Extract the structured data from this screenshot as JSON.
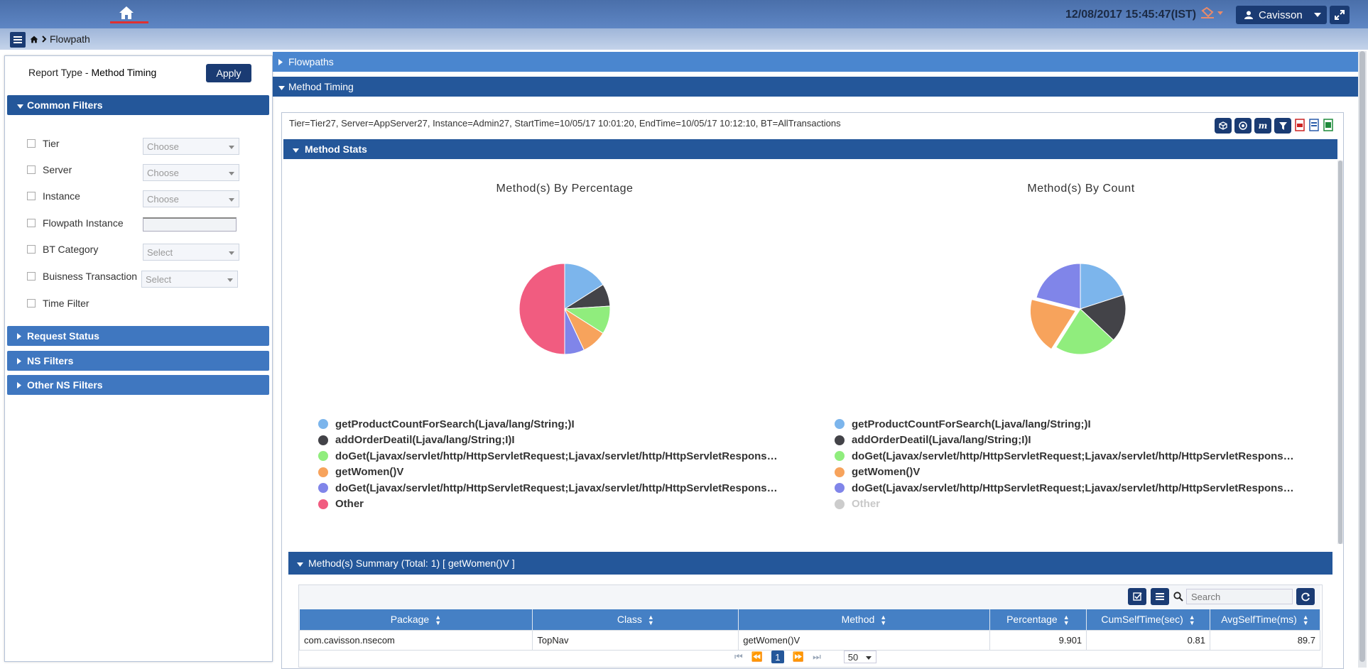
{
  "header": {
    "datetime": "12/08/2017 15:45:47(IST)",
    "user": "Cavisson"
  },
  "breadcrumb": {
    "current": "Flowpath"
  },
  "left_panel": {
    "report_type_label": "Report Type - ",
    "report_type_value": "Method Timing",
    "apply_label": "Apply",
    "common_filters": "Common Filters",
    "filters": [
      {
        "label": "Tier",
        "control": "Choose"
      },
      {
        "label": "Server",
        "control": "Choose"
      },
      {
        "label": "Instance",
        "control": "Choose"
      },
      {
        "label": "Flowpath Instance",
        "control": ""
      },
      {
        "label": "BT Category",
        "control": "Select"
      },
      {
        "label": "Buisness Transaction",
        "control": "Select"
      },
      {
        "label": "Time Filter",
        "control": ""
      }
    ],
    "sections": [
      "Request Status",
      "NS Filters",
      "Other NS Filters"
    ]
  },
  "main": {
    "flowpaths_label": "Flowpaths",
    "method_timing_label": "Method Timing",
    "info_line": "Tier=Tier27, Server=AppServer27, Instance=Admin27, StartTime=10/05/17 10:01:20, EndTime=10/05/17 10:12:10, BT=AllTransactions",
    "method_stats_label": "Method Stats",
    "summary_label": "Method(s) Summary (Total: 1) [ getWomen()V ]",
    "search_placeholder": "Search"
  },
  "colors": {
    "blue": "#7cb5ec",
    "dark": "#434348",
    "green": "#90ed7d",
    "orange": "#f7a35c",
    "purple": "#8085e9",
    "pink": "#f15c80",
    "grey": "#cccccc"
  },
  "chart_data": [
    {
      "type": "pie",
      "title": "Method(s) By Percentage",
      "series": [
        {
          "name": "getProductCountForSearch(Ljava/lang/String;)I",
          "value": 16,
          "color": "#7cb5ec"
        },
        {
          "name": "addOrderDeatil(Ljava/lang/String;I)I",
          "value": 8,
          "color": "#434348"
        },
        {
          "name": "doGet(Ljavax/servlet/http/HttpServletRequest;Ljavax/servlet/http/HttpServletRespons…",
          "value": 10,
          "color": "#90ed7d"
        },
        {
          "name": "getWomen()V",
          "value": 9,
          "color": "#f7a35c"
        },
        {
          "name": "doGet(Ljavax/servlet/http/HttpServletRequest;Ljavax/servlet/http/HttpServletRespons…",
          "value": 7,
          "color": "#8085e9"
        },
        {
          "name": "Other",
          "value": 50,
          "color": "#f15c80"
        }
      ]
    },
    {
      "type": "pie",
      "title": "Method(s) By Count",
      "series": [
        {
          "name": "getProductCountForSearch(Ljava/lang/String;)I",
          "value": 20,
          "color": "#7cb5ec"
        },
        {
          "name": "addOrderDeatil(Ljava/lang/String;I)I",
          "value": 17,
          "color": "#434348"
        },
        {
          "name": "doGet(Ljavax/servlet/http/HttpServletRequest;Ljavax/servlet/http/HttpServletRespons…",
          "value": 22,
          "color": "#90ed7d"
        },
        {
          "name": "getWomen()V",
          "value": 20,
          "color": "#f7a35c"
        },
        {
          "name": "doGet(Ljavax/servlet/http/HttpServletRequest;Ljavax/servlet/http/HttpServletRespons…",
          "value": 21,
          "color": "#8085e9"
        },
        {
          "name": "Other",
          "value": 0,
          "color": "#cccccc",
          "hidden": true
        }
      ]
    }
  ],
  "table": {
    "columns": [
      "Package",
      "Class",
      "Method",
      "Percentage",
      "CumSelfTime(sec)",
      "AvgSelfTime(ms)"
    ],
    "rows": [
      [
        "com.cavisson.nsecom",
        "TopNav",
        "getWomen()V",
        "9.901",
        "0.81",
        "89.7"
      ]
    ]
  },
  "pager": {
    "page": "1",
    "page_size": "50"
  }
}
